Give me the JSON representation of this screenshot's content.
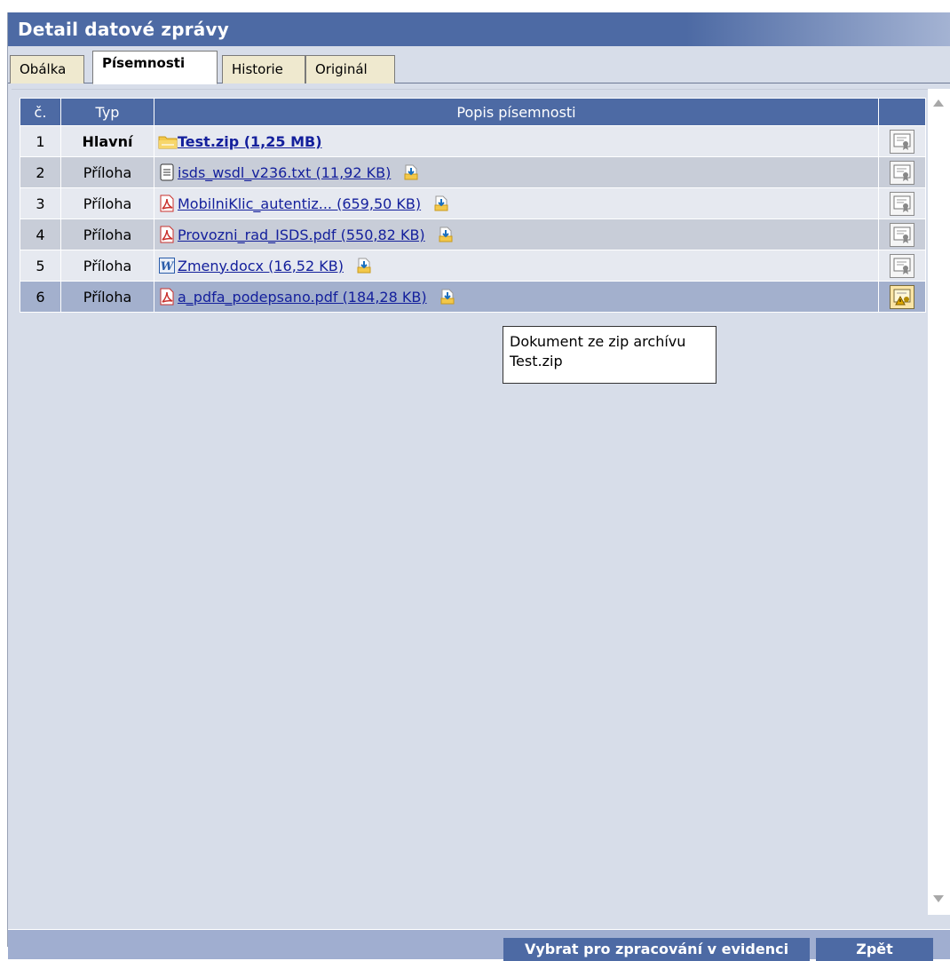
{
  "window": {
    "title": "Detail datové zprávy"
  },
  "tabs": [
    {
      "label": "Obálka"
    },
    {
      "label": "Písemnosti",
      "active": true
    },
    {
      "label": "Historie"
    },
    {
      "label": "Originál"
    }
  ],
  "table": {
    "headers": {
      "num": "č.",
      "type": "Typ",
      "description": "Popis písemnosti",
      "action": ""
    },
    "rows": [
      {
        "num": "1",
        "type": "Hlavní",
        "icon": "zip-icon",
        "file": "Test.zip (1,25 MB)",
        "download": false,
        "cert": "signature-cert-icon"
      },
      {
        "num": "2",
        "type": "Příloha",
        "icon": "text-file-icon",
        "file": "isds_wsdl_v236.txt (11,92 KB)",
        "download": true,
        "cert": "signature-cert-icon"
      },
      {
        "num": "3",
        "type": "Příloha",
        "icon": "pdf-icon",
        "file": "MobilniKlic_autentiz... (659,50 KB)",
        "download": true,
        "cert": "signature-cert-icon"
      },
      {
        "num": "4",
        "type": "Příloha",
        "icon": "pdf-icon",
        "file": "Provozni_rad_ISDS.pdf (550,82 KB)",
        "download": true,
        "cert": "signature-cert-icon"
      },
      {
        "num": "5",
        "type": "Příloha",
        "icon": "word-icon",
        "file": "Zmeny.docx (16,52 KB)",
        "download": true,
        "cert": "signature-cert-icon"
      },
      {
        "num": "6",
        "type": "Příloha",
        "icon": "pdf-icon",
        "file": "a_pdfa_podepsano.pdf (184,28 KB)",
        "download": true,
        "cert": "signature-warning-icon",
        "selected": true
      }
    ]
  },
  "tooltip": {
    "line1": "Dokument ze zip archívu",
    "line2": "Test.zip"
  },
  "footer": {
    "select_label": "Vybrat pro zpracování v evidenci",
    "back_label": "Zpět"
  },
  "colors": {
    "header_blue": "#4d6aa4",
    "panel_bg": "#d7dde9",
    "link": "#14209c",
    "selected_row": "#a3b0cd",
    "tab_bg": "#efe9cf"
  }
}
